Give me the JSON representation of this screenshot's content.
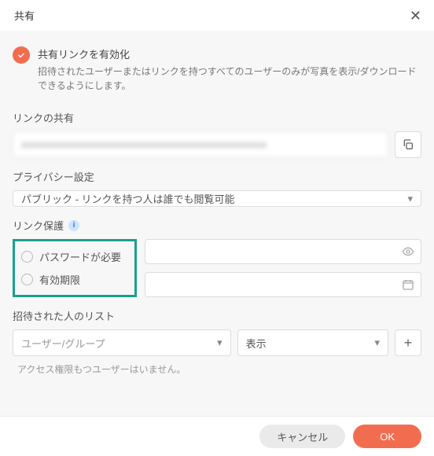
{
  "header": {
    "title": "共有"
  },
  "enable": {
    "title": "共有リンクを有効化",
    "desc": "招待されたユーザーまたはリンクを持つすべてのユーザーのみが写真を表示/ダウンロードできるようにします。"
  },
  "link": {
    "label": "リンクの共有",
    "value": "xxxxxxxxxxxxxxxxxxxxxxxxxxxxxxxxxxxxxxxxxxxxxxxx"
  },
  "privacy": {
    "label": "プライバシー設定",
    "value": "パブリック - リンクを持つ人は誰でも閲覧可能"
  },
  "protect": {
    "label": "リンク保護",
    "opt_password": "パスワードが必要",
    "opt_expiry": "有効期限"
  },
  "invite": {
    "label": "招待された人のリスト",
    "user_placeholder": "ユーザー/グループ",
    "perm_value": "表示",
    "empty": "アクセス権限もつユーザーはいません。"
  },
  "footer": {
    "cancel": "キャンセル",
    "ok": "OK"
  }
}
